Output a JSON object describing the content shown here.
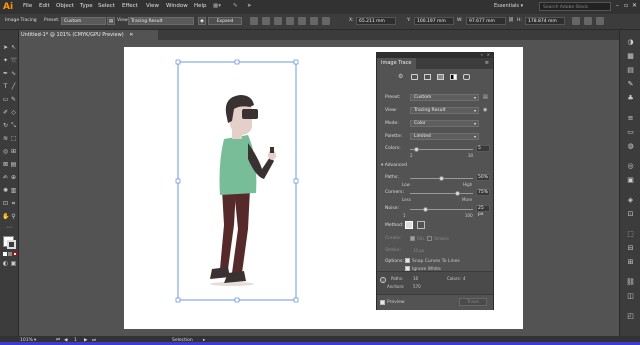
{
  "app": {
    "logo": "Ai"
  },
  "menu": [
    "File",
    "Edit",
    "Object",
    "Type",
    "Select",
    "Effect",
    "View",
    "Window",
    "Help"
  ],
  "workspace": {
    "label": "Essentials",
    "search_placeholder": "Search Adobe Stock"
  },
  "control_bar": {
    "image_tracing_label": "Image Tracing",
    "preset_label": "Preset:",
    "preset_value": "Custom",
    "view_label": "View:",
    "view_value": "Tracing Result",
    "expand_button": "Expand",
    "x_value": "65.211 mm",
    "y_value": "100.197 mm",
    "w_value": "97.677 mm",
    "h_value": "178.874 mm"
  },
  "document": {
    "tab_title": "Untitled-1* @ 101% (CMYK/GPU Preview)"
  },
  "status_bar": {
    "zoom": "101%",
    "page": "1",
    "tool": "Selection"
  },
  "image_trace": {
    "title": "Image Trace",
    "preset": {
      "label": "Preset:",
      "value": "Custom"
    },
    "view": {
      "label": "View:",
      "value": "Tracing Result"
    },
    "mode": {
      "label": "Mode:",
      "value": "Color"
    },
    "palette": {
      "label": "Palette:",
      "value": "Limited"
    },
    "colors": {
      "label": "Colors:",
      "value": "5",
      "min": "2",
      "max": "30",
      "level": 0.1
    },
    "advanced": {
      "label": "Advanced"
    },
    "paths": {
      "label": "Paths:",
      "value": "50%",
      "low": "Low",
      "high": "High",
      "level": 0.5
    },
    "corners": {
      "label": "Corners:",
      "value": "75%",
      "less": "Less",
      "more": "More",
      "level": 0.75
    },
    "noise": {
      "label": "Noise:",
      "value": "25 px",
      "min": "1",
      "max": "100",
      "level": 0.25
    },
    "method": {
      "label": "Method:"
    },
    "create": {
      "label": "Create:",
      "fills": "Fills",
      "strokes": "Strokes"
    },
    "stroke": {
      "label": "Stroke:",
      "value": "10 px"
    },
    "options": {
      "label": "Options:",
      "snap_curves": "Snap Curves To Lines",
      "ignore_white": "Ignore White"
    },
    "info": {
      "paths_label": "Paths:",
      "paths_value": "16",
      "colors_label": "Colors:",
      "colors_value": "4",
      "anchors_label": "Anchors:",
      "anchors_value": "570"
    },
    "preview": {
      "label": "Preview"
    },
    "trace_button": "Trace"
  },
  "colors": {
    "shirt": "#77bd97",
    "pants": "#562a2a",
    "skin": "#e4cfc9",
    "hair": "#3a3232",
    "selection": "#4a7fd8"
  }
}
